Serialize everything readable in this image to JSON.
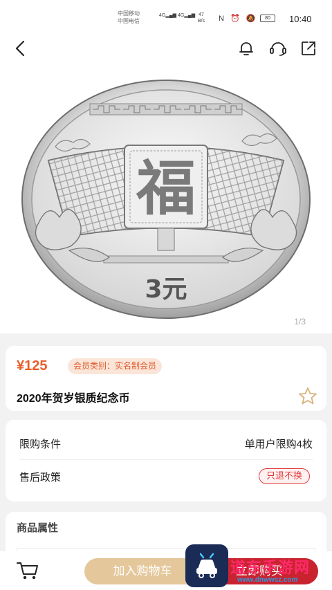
{
  "status_bar": {
    "carrier1": "中国移动",
    "carrier2": "中国电信",
    "net1": "4G",
    "net2": "4G",
    "speed_value": "47",
    "speed_unit": "B/s",
    "battery": "80",
    "time": "10:40"
  },
  "nav": {
    "back_icon": "chevron-left-icon",
    "bell_icon": "bell-icon",
    "service_icon": "headset-icon",
    "share_icon": "share-icon"
  },
  "gallery": {
    "pager": "1/3",
    "coin_denomination": "3元",
    "coin_character": "福"
  },
  "product": {
    "price": "¥125",
    "member_tag": "会员类别：实名制会员",
    "title": "2020年贺岁银质纪念币",
    "favorite_icon": "star-outline-icon"
  },
  "policy": {
    "limit_label": "限购条件",
    "limit_value": "单用户限购4枚",
    "after_sale_label": "售后政策",
    "after_sale_value": "只退不换"
  },
  "attributes": {
    "title": "商品属性"
  },
  "bottom_bar": {
    "cart_icon": "cart-icon",
    "add_to_cart": "加入购物车",
    "buy_now": "立即购买"
  },
  "watermark": {
    "text": "道东手游网",
    "url": "www.dnwwsz.com"
  },
  "colors": {
    "price": "#e85f2a",
    "buy_now": "#c8232f",
    "add_cart": "#e4c79a",
    "refund_tag": "#e03a3a"
  }
}
